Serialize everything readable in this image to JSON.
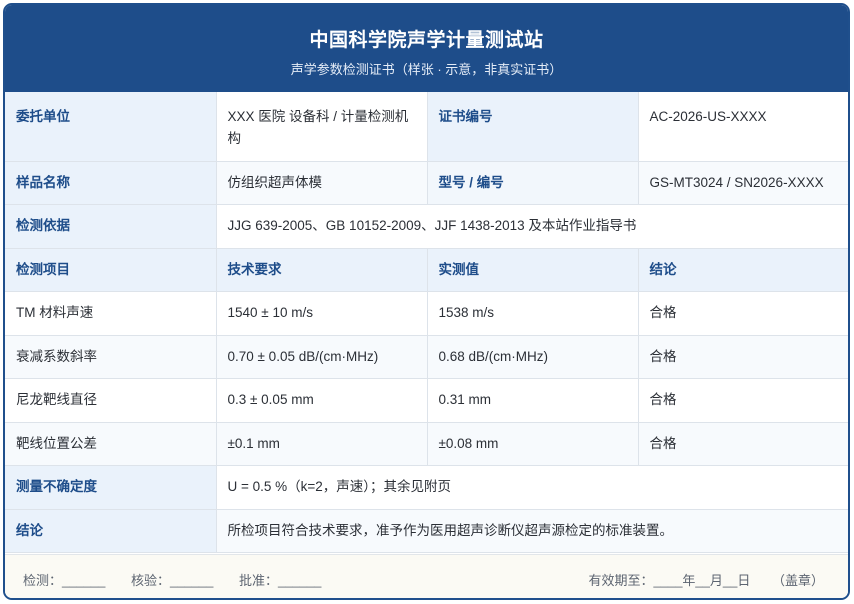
{
  "header": {
    "title": "中国科学院声学计量测试站",
    "subtitle": "声学参数检测证书（样张 · 示意，非真实证书）"
  },
  "info": {
    "client_label": "委托单位",
    "client_value": "XXX 医院 设备科 / 计量检测机构",
    "cert_no_label": "证书编号",
    "cert_no_value": "AC-2026-US-XXXX",
    "sample_label": "样品名称",
    "sample_value": "仿组织超声体模",
    "model_label": "型号 / 编号",
    "model_value": "GS-MT3024 / SN2026-XXXX",
    "basis_label": "检测依据",
    "basis_value": "JJG 639-2005、GB 10152-2009、JJF 1438-2013 及本站作业指导书"
  },
  "results": {
    "headers": [
      "检测项目",
      "技术要求",
      "实测值",
      "结论"
    ],
    "rows": [
      [
        "TM 材料声速",
        "1540 ± 10 m/s",
        "1538 m/s",
        "合格"
      ],
      [
        "衰减系数斜率",
        "0.70 ± 0.05 dB/(cm·MHz)",
        "0.68 dB/(cm·MHz)",
        "合格"
      ],
      [
        "尼龙靶线直径",
        "0.3 ± 0.05 mm",
        "0.31 mm",
        "合格"
      ],
      [
        "靶线位置公差",
        "±0.1 mm",
        "±0.08 mm",
        "合格"
      ]
    ]
  },
  "summary": {
    "uncertainty_label": "测量不确定度",
    "uncertainty_value": "U = 0.5 %（k=2，声速）；其余见附页",
    "conclusion_label": "结论",
    "conclusion_value": "所检项目符合技术要求，准予作为医用超声诊断仪超声源检定的标准装置。"
  },
  "footer": {
    "tester": "检测：______",
    "checker": "核验：______",
    "approver": "批准：______",
    "validity": "有效期至：____年__月__日",
    "seal": "（盖章）"
  }
}
